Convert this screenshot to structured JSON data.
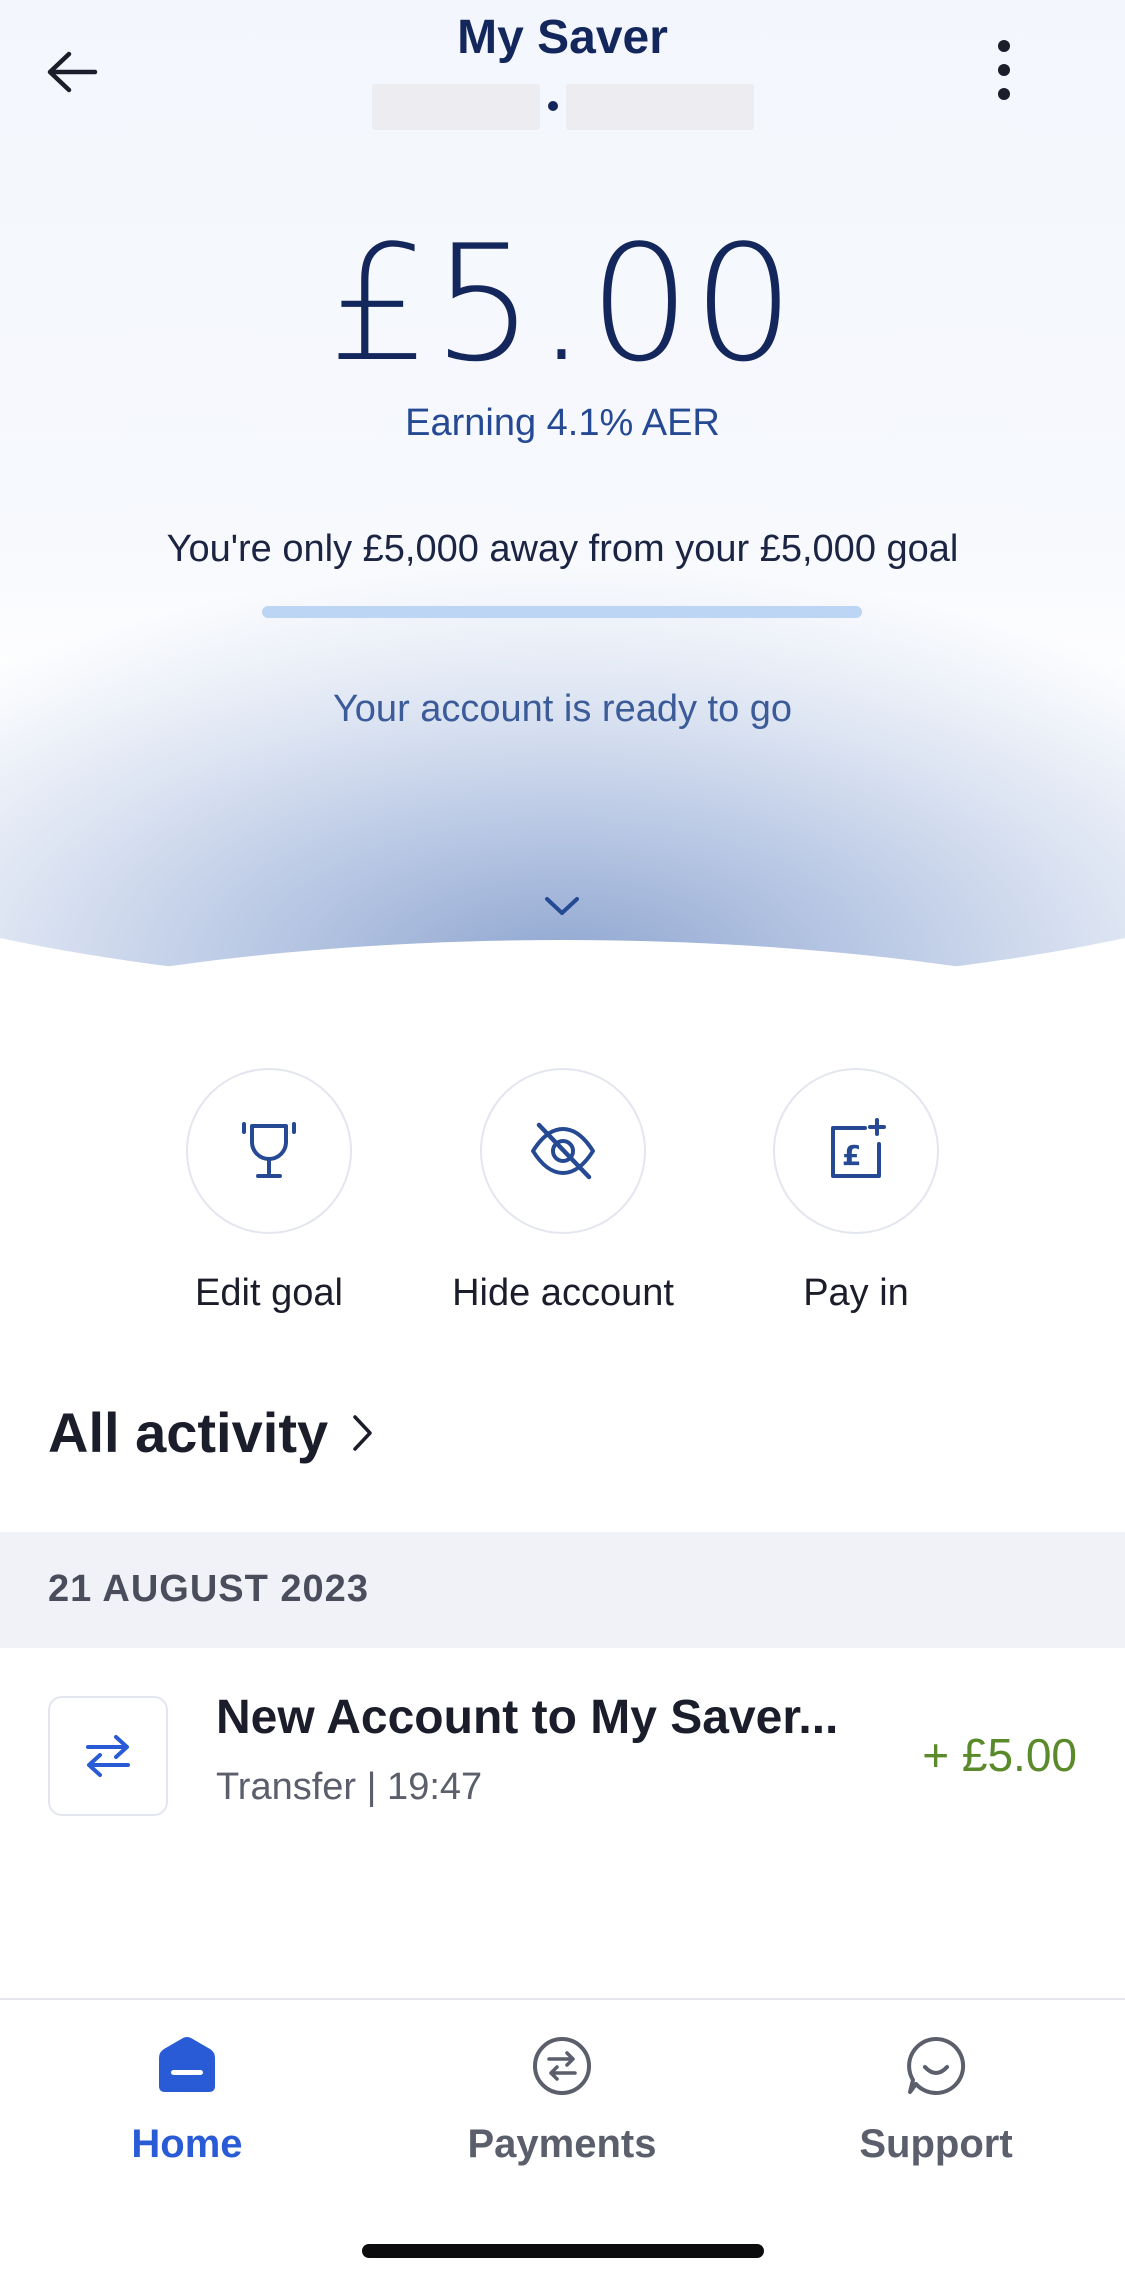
{
  "header": {
    "title": "My Saver",
    "back_icon": "arrow-left-icon",
    "more_icon": "more-vertical-icon"
  },
  "balance": {
    "amount": "£5.00",
    "rate_text": "Earning 4.1% AER",
    "goal_text": "You're only £5,000 away from your £5,000 goal",
    "goal_progress_percent": 0,
    "status_text": "Your account is ready to go",
    "expand_icon": "chevron-down-icon"
  },
  "actions": [
    {
      "label": "Edit goal",
      "icon": "trophy-icon"
    },
    {
      "label": "Hide account",
      "icon": "eye-off-icon"
    },
    {
      "label": "Pay in",
      "icon": "pay-in-icon"
    }
  ],
  "activity": {
    "title": "All activity",
    "date_header": "21 AUGUST 2023",
    "transactions": [
      {
        "name": "New Account to My Saver...",
        "meta": "Transfer | 19:47",
        "amount": "+ £5.00",
        "icon": "transfer-arrows-icon"
      }
    ]
  },
  "tabbar": {
    "tabs": [
      {
        "label": "Home",
        "icon": "home-icon",
        "active": true
      },
      {
        "label": "Payments",
        "icon": "payments-icon",
        "active": false
      },
      {
        "label": "Support",
        "icon": "support-icon",
        "active": false
      }
    ]
  },
  "colors": {
    "brand_navy": "#13275c",
    "accent_blue": "#2a5bd7",
    "credit_green": "#5a8a2a",
    "progress_track": "#bcd5f5"
  }
}
